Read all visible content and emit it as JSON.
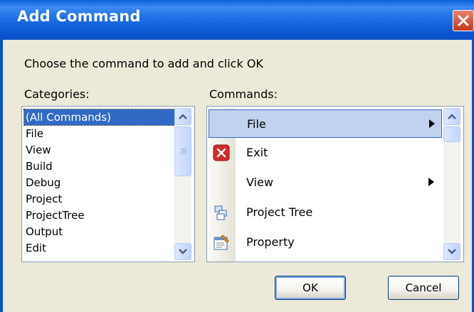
{
  "window": {
    "title": "Add Command"
  },
  "instruction": "Choose the command to add and click OK",
  "categories": {
    "label": "Categories:",
    "items": [
      "(All Commands)",
      "File",
      "View",
      "Build",
      "Debug",
      "Project",
      "ProjectTree",
      "Output",
      "Edit"
    ],
    "selected": "(All Commands)"
  },
  "commands": {
    "label": "Commands:",
    "items": [
      {
        "label": "File",
        "icon": "none",
        "submenu": true
      },
      {
        "label": "Exit",
        "icon": "exit-icon",
        "submenu": false
      },
      {
        "label": "View",
        "icon": "none",
        "submenu": true
      },
      {
        "label": "Project Tree",
        "icon": "project-tree-icon",
        "submenu": false
      },
      {
        "label": "Property",
        "icon": "property-icon",
        "submenu": false
      }
    ],
    "hovered": "File"
  },
  "buttons": {
    "ok": "OK",
    "cancel": "Cancel"
  },
  "colors": {
    "titlebar": "#0A5FD8",
    "face": "#ECE9D8",
    "selection": "#316AC5",
    "hover": "#C1D2EE"
  }
}
